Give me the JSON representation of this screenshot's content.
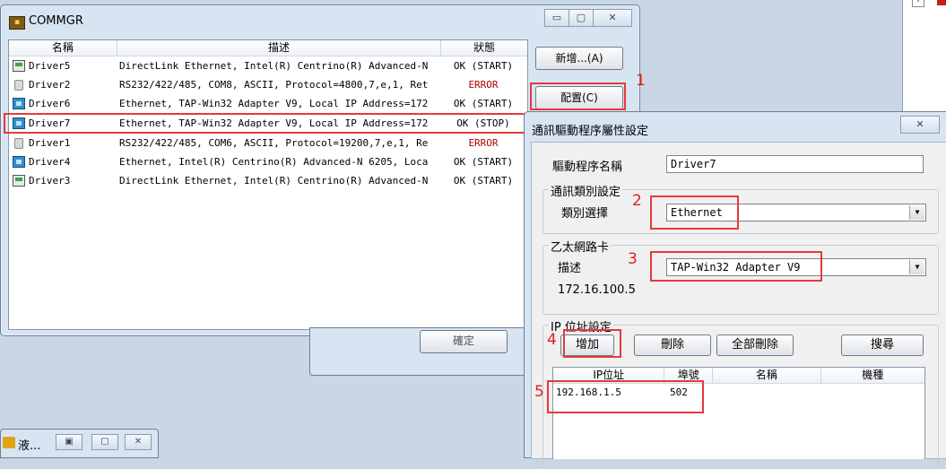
{
  "window": {
    "title": "COMMGR",
    "buttons": {
      "minimize": "▭",
      "maximize": "▢",
      "close": "✕"
    },
    "add_button": "新增...(A)",
    "config_button": "配置(C)"
  },
  "driver_list": {
    "columns": [
      "名稱",
      "描述",
      "狀態"
    ],
    "rows": [
      {
        "name": "Driver5",
        "desc": "DirectLink Ethernet, Intel(R) Centrino(R) Advanced-N",
        "status": "OK (START)",
        "icon": "direct-link-icon"
      },
      {
        "name": "Driver2",
        "desc": "RS232/422/485, COM8, ASCII, Protocol=4800,7,e,1, Ret",
        "status": "ERROR",
        "icon": "serial-port-icon"
      },
      {
        "name": "Driver6",
        "desc": "Ethernet, TAP-Win32 Adapter V9, Local IP Address=172",
        "status": "OK (START)",
        "icon": "network-icon"
      },
      {
        "name": "Driver7",
        "desc": "Ethernet, TAP-Win32 Adapter V9, Local IP Address=172",
        "status": "OK (STOP)",
        "icon": "network-icon"
      },
      {
        "name": "Driver1",
        "desc": "RS232/422/485, COM6, ASCII, Protocol=19200,7,e,1, Re",
        "status": "ERROR",
        "icon": "serial-port-icon"
      },
      {
        "name": "Driver4",
        "desc": "Ethernet, Intel(R) Centrino(R) Advanced-N 6205, Loca",
        "status": "OK (START)",
        "icon": "network-icon"
      },
      {
        "name": "Driver3",
        "desc": "DirectLink Ethernet, Intel(R) Centrino(R) Advanced-N",
        "status": "OK (START)",
        "icon": "direct-link-icon"
      }
    ]
  },
  "annotations": [
    "1",
    "2",
    "3",
    "4",
    "5"
  ],
  "behind_dialog": {
    "ok_button": "確定"
  },
  "taskbar": {
    "label": "液..."
  },
  "props_dialog": {
    "title": "通訊驅動程序屬性設定",
    "close": "✕",
    "driver_name_label": "驅動程序名稱",
    "driver_name_value": "Driver7",
    "comm_group": "通訊類別設定",
    "type_label": "類別選擇",
    "type_value": "Ethernet",
    "ethernet_group": "乙太網路卡",
    "desc_label": "描述",
    "adapter_value": "TAP-Win32 Adapter V9",
    "ip_address_text": "172.16.100.5",
    "ip_group": "IP 位址設定",
    "add_button": "增加",
    "delete_button": "刪除",
    "delete_all_button": "全部刪除",
    "search_button": "搜尋",
    "ip_columns": [
      "IP位址",
      "埠號",
      "名稱",
      "機種"
    ],
    "ip_rows": [
      {
        "ip": "192.168.1.5",
        "port": "502",
        "name": "",
        "model": ""
      }
    ]
  },
  "colors": {
    "highlight": "#e23b3b",
    "window_frame": "#d7e4f2",
    "error_text": "#b00000"
  }
}
